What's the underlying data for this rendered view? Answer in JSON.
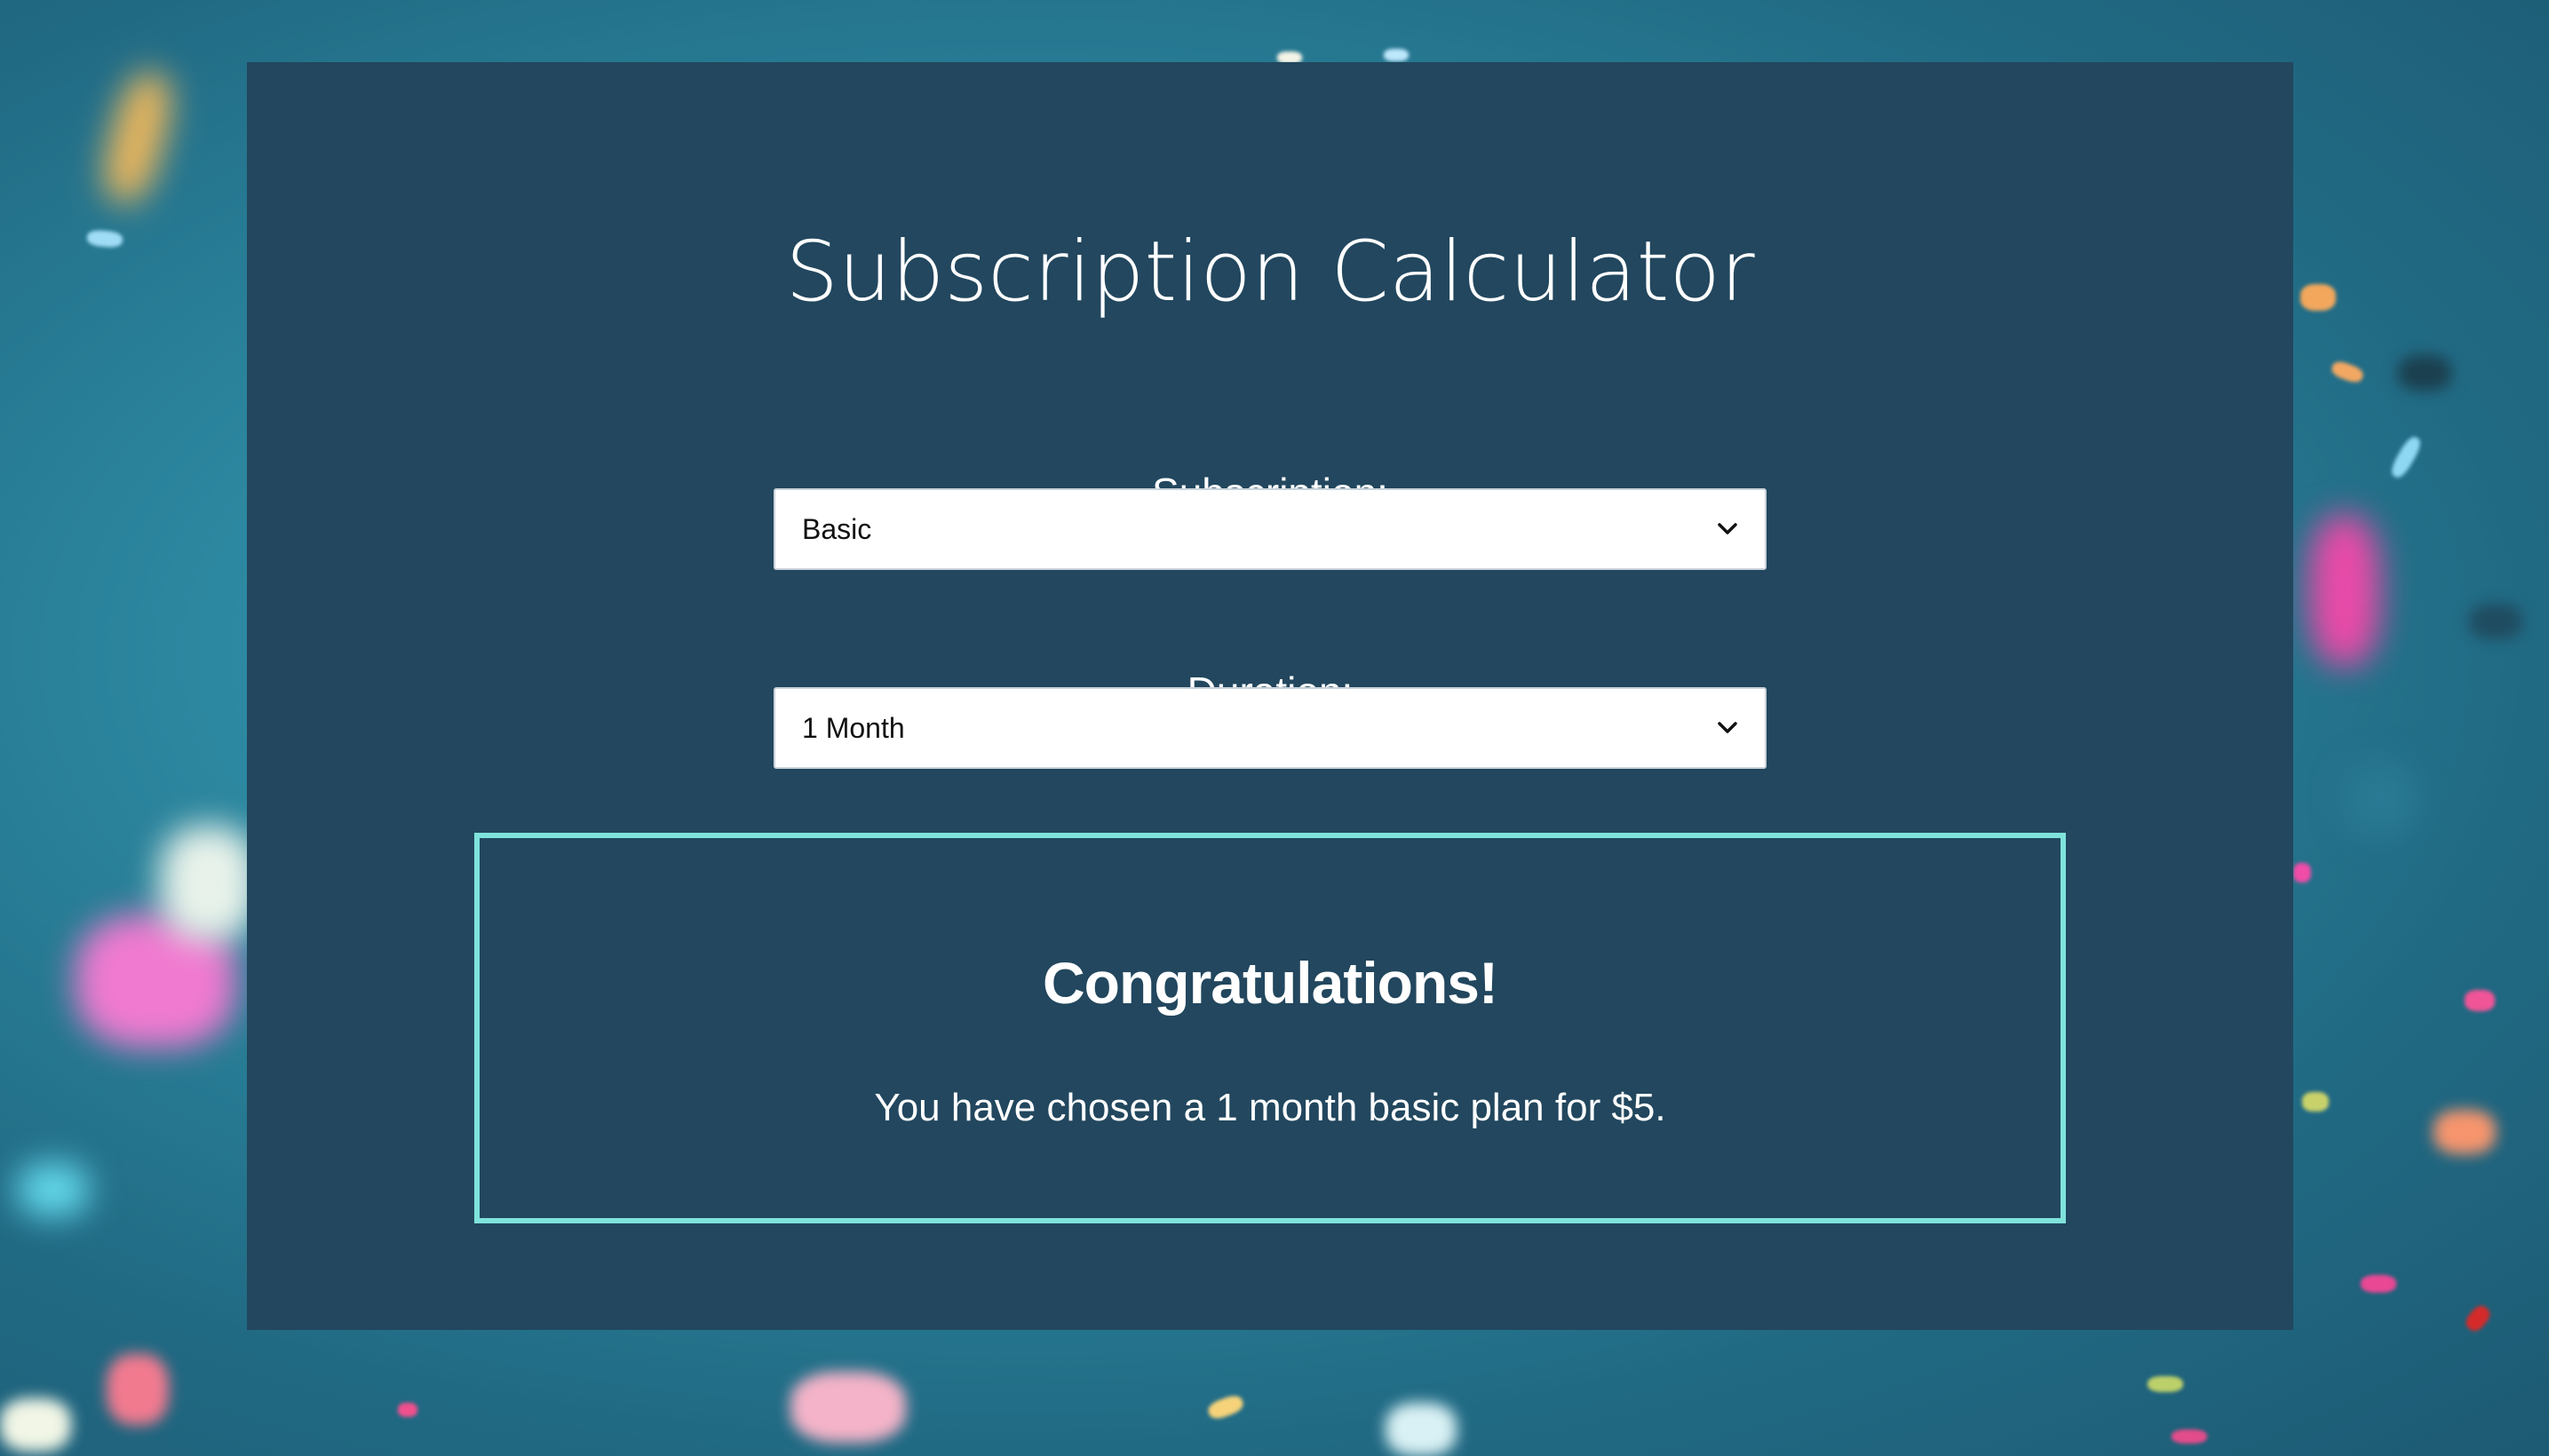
{
  "page": {
    "title": "Subscription Calculator"
  },
  "form": {
    "subscription_label": "Subscription:",
    "subscription_value": "Basic",
    "duration_label": "Duration:",
    "duration_value": "1 Month"
  },
  "result": {
    "heading": "Congratulations!",
    "message": "You have chosen a 1 month basic plan for $5."
  },
  "colors": {
    "panel_background": "#22475e",
    "result_border": "#7fe3dc",
    "page_background": "#2d8aa2",
    "text": "#ffffff"
  },
  "icons": {
    "dropdown": "chevron-down-icon"
  }
}
